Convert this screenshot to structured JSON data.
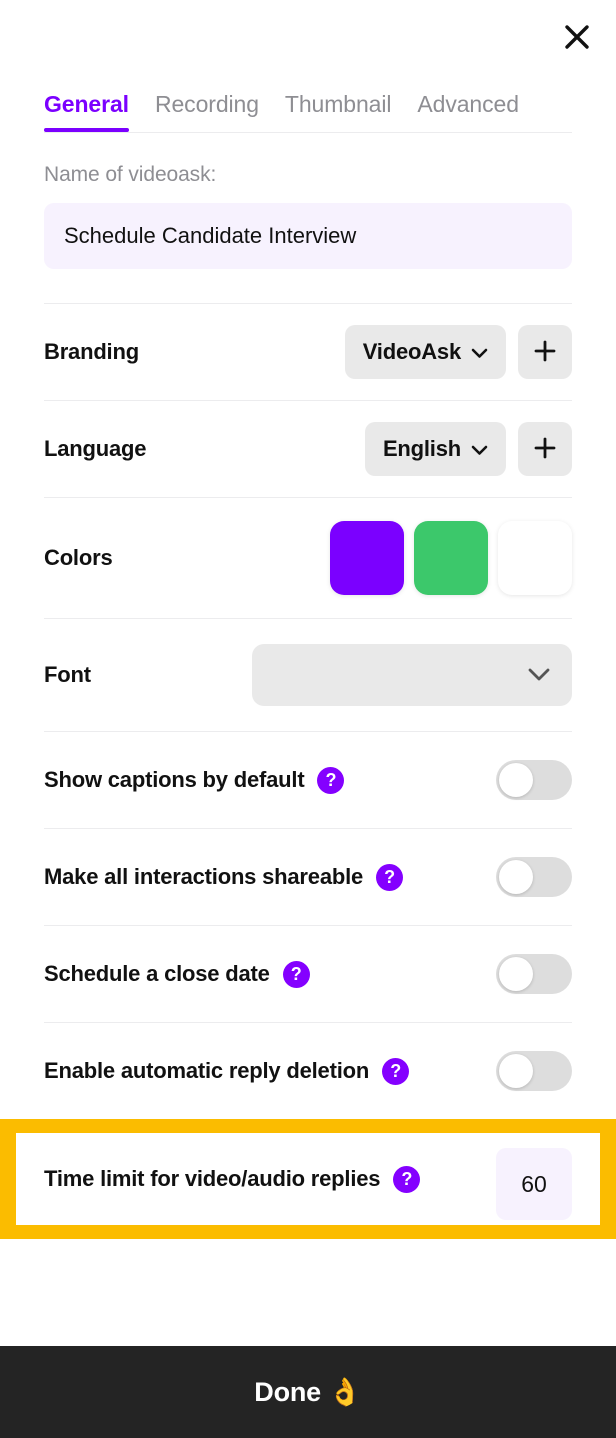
{
  "header": {
    "close_icon": "close-icon"
  },
  "tabs": [
    {
      "label": "General",
      "active": true
    },
    {
      "label": "Recording",
      "active": false
    },
    {
      "label": "Thumbnail",
      "active": false
    },
    {
      "label": "Advanced",
      "active": false
    }
  ],
  "name_field": {
    "label": "Name of videoask:",
    "value": "Schedule Candidate Interview",
    "placeholder": "Name of videoask"
  },
  "branding": {
    "label": "Branding",
    "selected": "VideoAsk",
    "chevron_icon": "chevron-down-icon",
    "add_icon": "plus-icon"
  },
  "language": {
    "label": "Language",
    "selected": "English",
    "chevron_icon": "chevron-down-icon",
    "add_icon": "plus-icon"
  },
  "colors": {
    "label": "Colors",
    "swatches": [
      {
        "name": "primary",
        "hex": "#7B00FF"
      },
      {
        "name": "secondary",
        "hex": "#3CC86B"
      },
      {
        "name": "background",
        "hex": "#FFFFFF"
      }
    ]
  },
  "font": {
    "label": "Font",
    "selected": "",
    "chevron_icon": "chevron-down-icon"
  },
  "toggles": [
    {
      "label": "Show captions by default",
      "help": "?",
      "on": false
    },
    {
      "label": "Make all interactions shareable",
      "help": "?",
      "on": false
    },
    {
      "label": "Schedule a close date",
      "help": "?",
      "on": false
    },
    {
      "label": "Enable automatic reply deletion",
      "help": "?",
      "on": false
    }
  ],
  "time_limit": {
    "label": "Time limit for video/audio replies",
    "help": "?",
    "value": "60",
    "highlight_color": "#FBBC00"
  },
  "footer": {
    "done_label": "Done 👌"
  },
  "accent": {
    "purple": "#7B00FF",
    "help_purple": "#8400FF",
    "dark": "#242424"
  }
}
